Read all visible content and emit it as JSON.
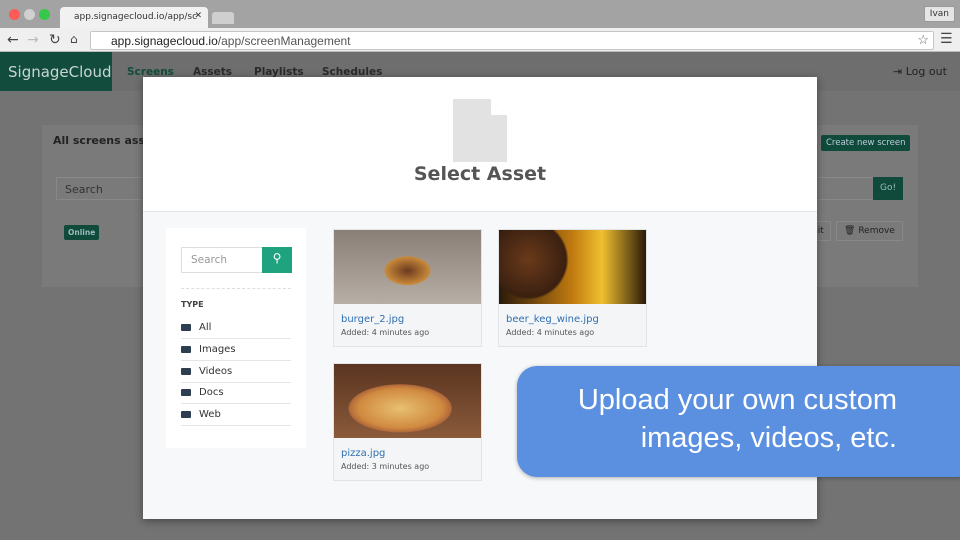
{
  "browser": {
    "tab_title": "app.signagecloud.io/app/sc",
    "url_host": "app.signagecloud.io",
    "url_path": "/app/screenManagement",
    "user": "Ivan"
  },
  "nav": {
    "brand": "SignageCloud",
    "items": [
      "Screens",
      "Assets",
      "Playlists",
      "Schedules"
    ],
    "logout": "Log out"
  },
  "background": {
    "panel_title": "All screens assigne",
    "create_button": "Create new screen",
    "search_placeholder": "Search",
    "go_button": "Go!",
    "status_badge": "Online",
    "edit_button": "dit",
    "remove_button": "Remove"
  },
  "modal": {
    "title": "Select Asset",
    "search_placeholder": "Search",
    "type_heading": "TYPE",
    "types": [
      "All",
      "Images",
      "Videos",
      "Docs",
      "Web"
    ],
    "assets": [
      {
        "name": "burger_2.jpg",
        "added": "Added: 4 minutes ago"
      },
      {
        "name": "beer_keg_wine.jpg",
        "added": "Added: 4 minutes ago"
      },
      {
        "name": "pizza.jpg",
        "added": "Added: 3 minutes ago"
      }
    ]
  },
  "callout": {
    "line1": "Upload your own custom",
    "line2": "images, videos, etc."
  },
  "colors": {
    "accent": "#1fa37f",
    "brand_bg": "#124c3c",
    "callout": "#5b8fe0",
    "link": "#2f6fb0"
  }
}
